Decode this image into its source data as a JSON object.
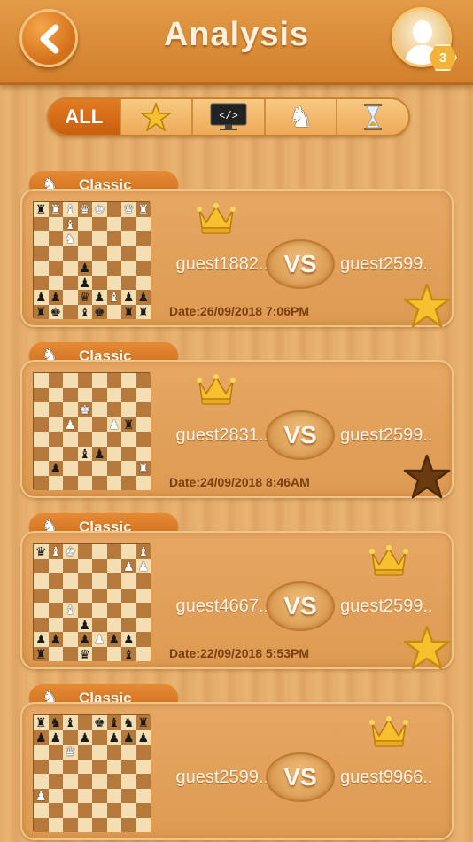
{
  "header": {
    "title": "Analysis",
    "level_badge": "3"
  },
  "filter_tabs": [
    {
      "label": "ALL",
      "icon": "",
      "active": true
    },
    {
      "label": "",
      "icon": "star-icon",
      "active": false
    },
    {
      "label": "",
      "icon": "computer-icon",
      "active": false
    },
    {
      "label": "",
      "icon": "knight-icon",
      "active": false
    },
    {
      "label": "",
      "icon": "hourglass-icon",
      "active": false
    }
  ],
  "computer_icon_text": "</>",
  "games": [
    {
      "mode": "Classic",
      "player_left": "guest1882..",
      "player_right": "guest2599..",
      "vs": "VS",
      "date": "Date:26/09/2018 7:06PM",
      "winner": "left",
      "favorite": true,
      "board": [
        "rRBQK.QR",
        "..B.....",
        "..N.....",
        "........",
        "...p....",
        "...p....",
        "pp.qpBpp",
        "rk.bk.rr"
      ]
    },
    {
      "mode": "Classic",
      "player_left": "guest2831..",
      "player_right": "guest2599..",
      "vs": "VS",
      "date": "Date:24/09/2018 8:46AM",
      "winner": "left",
      "favorite": false,
      "board": [
        "........",
        "........",
        "...K....",
        "..P..Pr.",
        "........",
        "...bp...",
        ".p.....R",
        "........"
      ]
    },
    {
      "mode": "Classic",
      "player_left": "guest4667..",
      "player_right": "guest2599..",
      "vs": "VS",
      "date": "Date:22/09/2018 5:53PM",
      "winner": "right",
      "favorite": true,
      "board": [
        "qBK....B",
        "......PP",
        "........",
        "........",
        "..B.....",
        "...p....",
        "pp.pPpp.",
        "r..q..b."
      ]
    },
    {
      "mode": "Classic",
      "player_left": "guest2599..",
      "player_right": "guest9966..",
      "vs": "VS",
      "date": "",
      "winner": "right",
      "favorite": false,
      "board": [
        "rnb.kbnr",
        "pp.p.ppp",
        "..Q.....",
        "........",
        "........",
        "P.......",
        "........",
        "........"
      ]
    }
  ],
  "colors": {
    "accent": "#d2802c",
    "text_light": "#fff4e6",
    "date_text": "#7a3f10",
    "star_gold": "#f6c02e",
    "star_empty": "#6b3b10"
  }
}
